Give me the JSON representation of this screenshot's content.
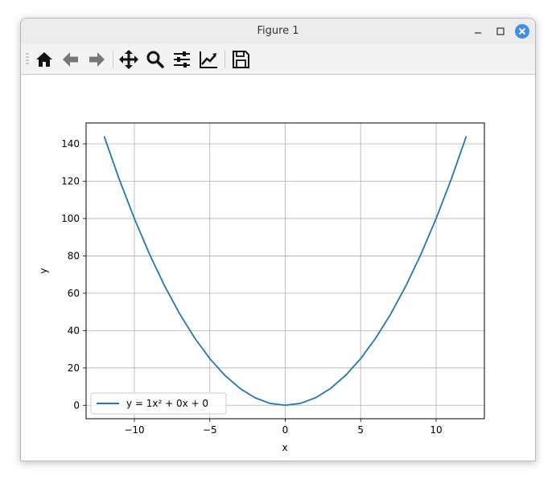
{
  "window": {
    "title": "Figure 1"
  },
  "titlebar_buttons": [
    {
      "name": "minimize",
      "icon": "minimize-icon"
    },
    {
      "name": "maximize",
      "icon": "maximize-icon"
    },
    {
      "name": "close",
      "icon": "close-icon"
    }
  ],
  "toolbar": {
    "tools": [
      {
        "name": "home",
        "icon": "home-icon"
      },
      {
        "name": "back",
        "icon": "back-arrow-icon"
      },
      {
        "name": "forward",
        "icon": "forward-arrow-icon"
      },
      {
        "name": "pan",
        "icon": "move-icon"
      },
      {
        "name": "zoom",
        "icon": "zoom-icon"
      },
      {
        "name": "configure-subplots",
        "icon": "sliders-icon"
      },
      {
        "name": "edit-axes",
        "icon": "line-chart-icon"
      },
      {
        "name": "save",
        "icon": "save-icon"
      }
    ]
  },
  "colors": {
    "line": "#1f77b4",
    "close_button": "#3d8fe0",
    "grid": "#b0b0b0"
  },
  "chart_data": {
    "type": "line",
    "title": "",
    "xlabel": "x",
    "ylabel": "y",
    "xlim": [
      -13.2,
      13.2
    ],
    "ylim": [
      -7.2,
      151.2
    ],
    "xticks": [
      -10,
      -5,
      0,
      5,
      10
    ],
    "xtick_labels": [
      "−10",
      "−5",
      "0",
      "5",
      "10"
    ],
    "yticks": [
      0,
      20,
      40,
      60,
      80,
      100,
      120,
      140
    ],
    "ytick_labels": [
      "0",
      "20",
      "40",
      "60",
      "80",
      "100",
      "120",
      "140"
    ],
    "grid": true,
    "legend_position": "lower-left",
    "series": [
      {
        "name": "y = 1x² + 0x + 0",
        "x": [
          -12,
          -11,
          -10,
          -9,
          -8,
          -7,
          -6,
          -5,
          -4,
          -3,
          -2,
          -1,
          0,
          1,
          2,
          3,
          4,
          5,
          6,
          7,
          8,
          9,
          10,
          11,
          12
        ],
        "y": [
          144,
          121,
          100,
          81,
          64,
          49,
          36,
          25,
          16,
          9,
          4,
          1,
          0,
          1,
          4,
          9,
          16,
          25,
          36,
          49,
          64,
          81,
          100,
          121,
          144
        ]
      }
    ]
  }
}
